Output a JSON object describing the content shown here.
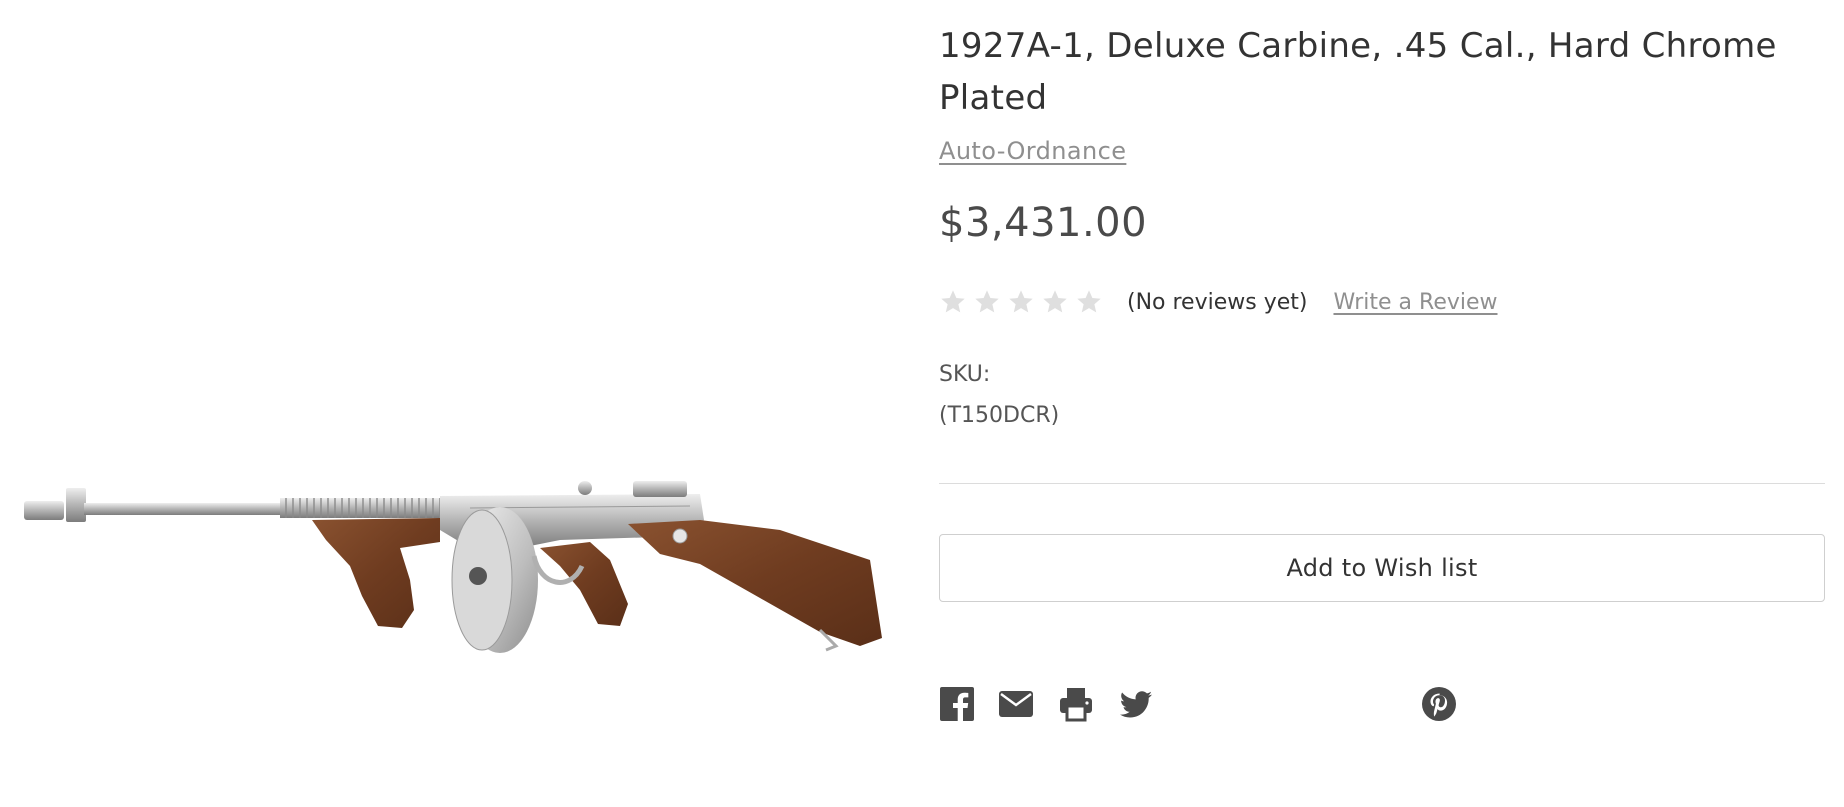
{
  "product": {
    "title": "1927A-1, Deluxe Carbine, .45 Cal., Hard Chrome Plated",
    "brand": "Auto-Ordnance",
    "price": "$3,431.00",
    "rating": {
      "value": 0,
      "max": 5,
      "no_reviews_text": "(No reviews yet)",
      "write_review_label": "Write a Review"
    },
    "sku_label": "SKU:",
    "sku_value": "(T150DCR)"
  },
  "actions": {
    "wishlist_label": "Add to Wish list"
  },
  "share": {
    "icons": [
      "facebook-icon",
      "email-icon",
      "print-icon",
      "twitter-icon",
      "pinterest-icon"
    ]
  },
  "colors": {
    "text": "#333333",
    "muted": "#8f8f8f",
    "star_empty": "#dfdfdf",
    "icon": "#4a4a4a"
  }
}
